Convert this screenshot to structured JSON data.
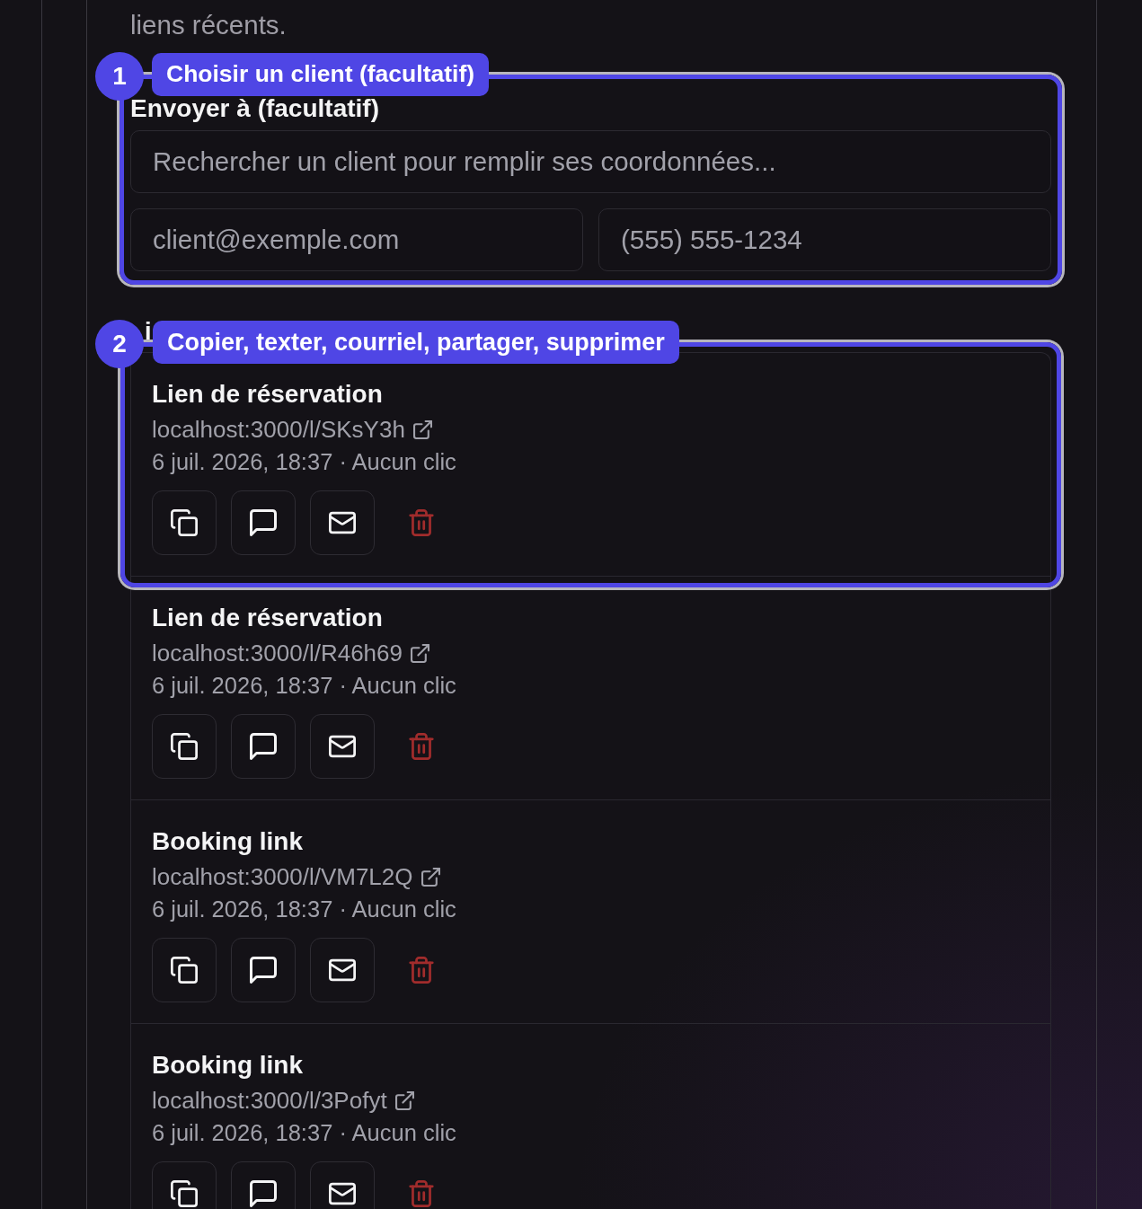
{
  "intro": {
    "text": "liens récents."
  },
  "recipient": {
    "callout": {
      "number": "1",
      "label": "Choisir un client (facultatif)"
    },
    "label": "Envoyer à (facultatif)",
    "search_field": {
      "placeholder": "Rechercher un client pour remplir ses coordonnées..."
    },
    "email_field": {
      "placeholder": "client@exemple.com"
    },
    "phone_field": {
      "placeholder": "(555) 555-1234"
    }
  },
  "links": {
    "heading": "i",
    "callout": {
      "number": "2",
      "label": "Copier, texter, courriel, partager, supprimer"
    },
    "items": [
      {
        "title": "Lien de réservation",
        "url": "localhost:3000/l/SKsY3h",
        "meta": "6 juil. 2026, 18:37 · Aucun clic",
        "highlighted": true
      },
      {
        "title": "Lien de réservation",
        "url": "localhost:3000/l/R46h69",
        "meta": "6 juil. 2026, 18:37 · Aucun clic",
        "highlighted": false
      },
      {
        "title": "Booking link",
        "url": "localhost:3000/l/VM7L2Q",
        "meta": "6 juil. 2026, 18:37 · Aucun clic",
        "highlighted": false
      },
      {
        "title": "Booking link",
        "url": "localhost:3000/l/3Pofyt",
        "meta": "6 juil. 2026, 18:37 · Aucun clic",
        "highlighted": false
      }
    ]
  }
}
